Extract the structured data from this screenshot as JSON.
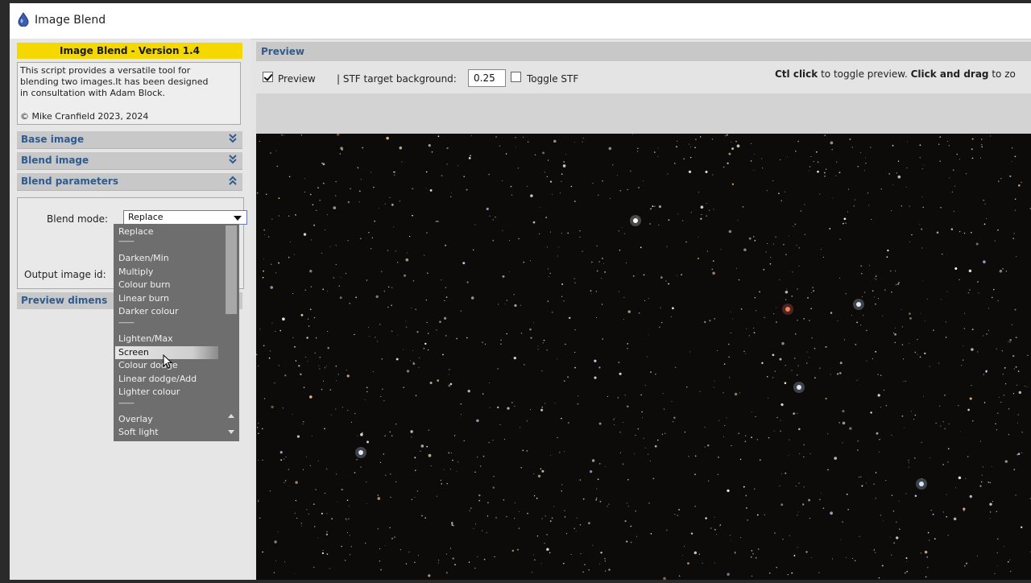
{
  "window": {
    "title": "Image Blend",
    "app_icon": "pixinsight-drop-icon"
  },
  "left_panel": {
    "version_banner": "Image Blend - Version 1.4",
    "description": [
      "This script provides a versatile tool for",
      "blending two images.It has been designed",
      "in consultation with Adam Block."
    ],
    "copyright": "© Mike Cranfield 2023, 2024",
    "sections": [
      {
        "label": "Base image",
        "state": "collapsed"
      },
      {
        "label": "Blend image",
        "state": "collapsed"
      },
      {
        "label": "Blend parameters",
        "state": "expanded"
      }
    ],
    "blend_mode_label": "Blend mode:",
    "blend_mode_value": "Replace",
    "output_image_id_label": "Output image id:",
    "preview_dimensions_section": "Preview dimens"
  },
  "blend_dropdown": {
    "options": [
      "Replace",
      "----------",
      "Darken/Min",
      "Multiply",
      "Colour burn",
      "Linear burn",
      "Darker colour",
      "----------",
      "Lighten/Max",
      "Screen",
      "Colour dodge",
      "Linear dodge/Add",
      "Lighter colour",
      "----------",
      "Overlay",
      "Soft light"
    ],
    "highlighted": "Screen"
  },
  "preview_panel": {
    "header": "Preview",
    "preview_checkbox_label": "Preview",
    "preview_checked": true,
    "stf_label": "| STF target background:",
    "stf_value": "0.25",
    "toggle_stf_label": "Toggle STF",
    "toggle_stf_checked": false,
    "hint_ctrl": "Ctl click",
    "hint_mid": " to toggle preview. ",
    "hint_drag": "Click and drag",
    "hint_end": " to zo"
  },
  "colors": {
    "accent_blue": "#2f5b8f",
    "banner_yellow": "#f4d800",
    "panel_grey": "#e4e4e4",
    "starfield_bg": "#0d0b0a"
  }
}
